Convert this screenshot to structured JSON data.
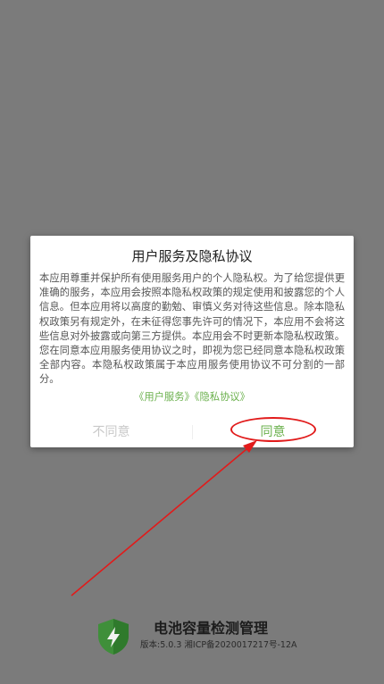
{
  "dialog": {
    "title": "用户服务及隐私协议",
    "body": "本应用尊重并保护所有使用服务用户的个人隐私权。为了给您提供更准确的服务，本应用会按照本隐私权政策的规定使用和披露您的个人信息。但本应用将以高度的勤勉、审慎义务对待这些信息。除本隐私权政策另有规定外，在未征得您事先许可的情况下，本应用不会将这些信息对外披露或向第三方提供。本应用会不时更新本隐私权政策。您在同意本应用服务使用协议之时，即视为您已经同意本隐私权政策全部内容。本隐私权政策属于本应用服务使用协议不可分割的一部分。",
    "user_service_link": "《用户服务》",
    "privacy_link": "《隐私协议》",
    "disagree_label": "不同意",
    "agree_label": "同意"
  },
  "footer": {
    "app_name": "电池容量检测管理",
    "version": "版本:5.0.3  湘ICP备2020017217号-12A"
  },
  "colors": {
    "accent": "#6ab04c",
    "overlay": "#7b7b7b",
    "annotation": "#e11b1b"
  },
  "icons": {
    "logo": "shield-bolt-icon"
  }
}
